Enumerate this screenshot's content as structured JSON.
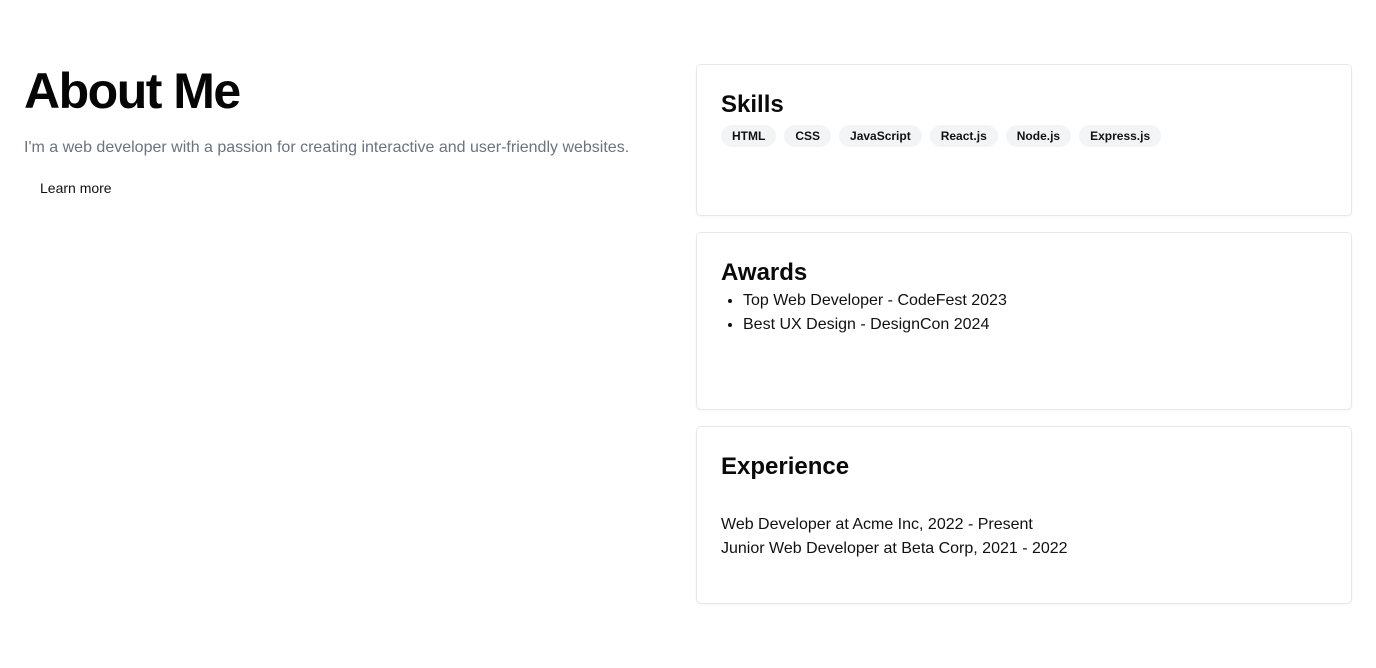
{
  "hero": {
    "title": "About Me",
    "tagline": "I'm a web developer with a passion for creating interactive and user-friendly websites.",
    "cta_label": "Learn more"
  },
  "skills": {
    "title": "Skills",
    "tags": [
      "HTML",
      "CSS",
      "JavaScript",
      "React.js",
      "Node.js",
      "Express.js"
    ]
  },
  "awards": {
    "title": "Awards",
    "items": [
      "Top Web Developer - CodeFest 2023",
      "Best UX Design - DesignCon 2024"
    ]
  },
  "experience": {
    "title": "Experience",
    "items": [
      "Web Developer at Acme Inc, 2022 - Present",
      "Junior Web Developer at Beta Corp, 2021 - 2022"
    ]
  },
  "colors": {
    "muted_text": "#6b7280",
    "tag_background": "#f3f4f6",
    "card_border": "#e5e7eb"
  }
}
